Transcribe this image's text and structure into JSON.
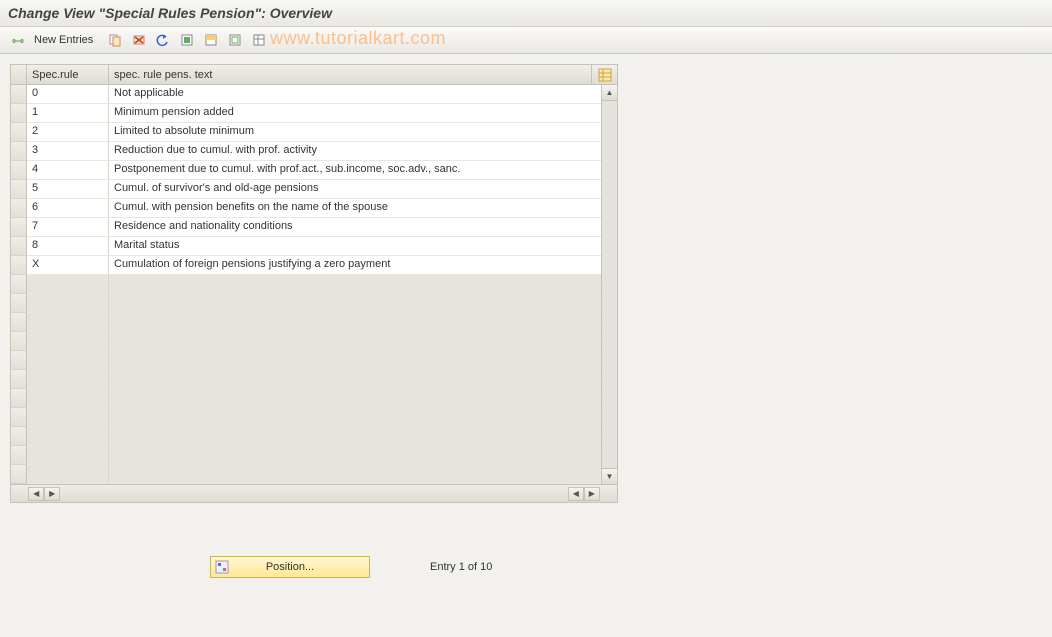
{
  "header": {
    "title": "Change View \"Special Rules Pension\": Overview"
  },
  "toolbar": {
    "new_entries_label": "New Entries"
  },
  "watermark": "www.tutorialkart.com",
  "table": {
    "col1_header": "Spec.rule",
    "col2_header": "spec. rule pens. text",
    "rows": [
      {
        "rule": "0",
        "text": "Not applicable"
      },
      {
        "rule": "1",
        "text": "Minimum pension added"
      },
      {
        "rule": "2",
        "text": "Limited to absolute minimum"
      },
      {
        "rule": "3",
        "text": "Reduction due to cumul. with prof. activity"
      },
      {
        "rule": "4",
        "text": "Postponement due to cumul. with prof.act., sub.income, soc.adv., sanc."
      },
      {
        "rule": "5",
        "text": "Cumul. of survivor's and old-age pensions"
      },
      {
        "rule": "6",
        "text": "Cumul. with pension benefits on the name of the spouse"
      },
      {
        "rule": "7",
        "text": "Residence and nationality conditions"
      },
      {
        "rule": "8",
        "text": "Marital status"
      },
      {
        "rule": "X",
        "text": "Cumulation of foreign pensions justifying a zero payment"
      }
    ],
    "empty_rows": 11
  },
  "footer": {
    "position_label": "Position...",
    "entry_label": "Entry 1 of 10"
  }
}
